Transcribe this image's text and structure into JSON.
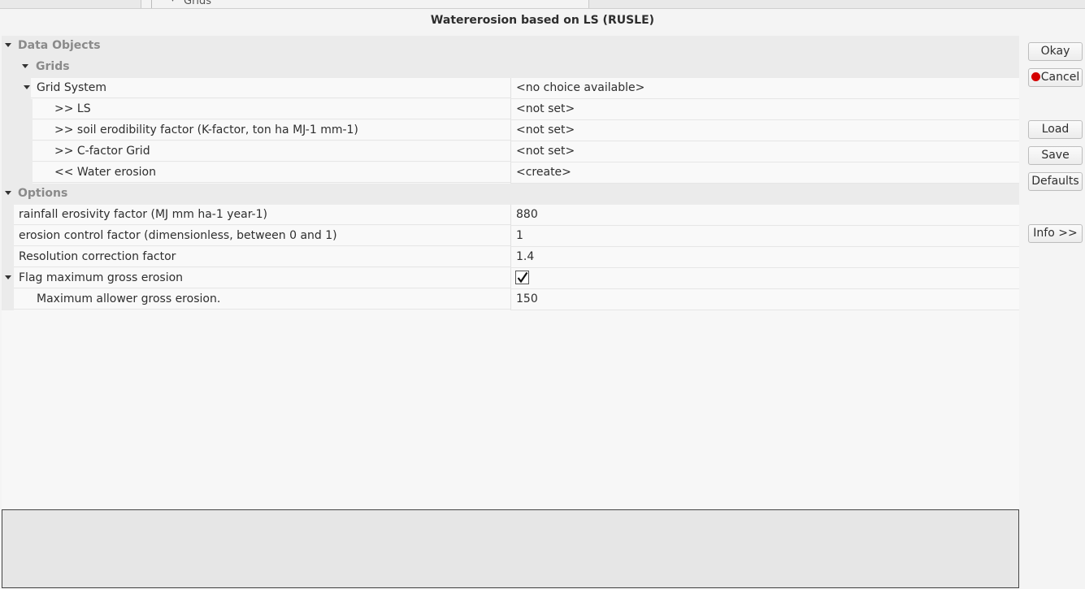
{
  "background_app": {
    "partial_label": "Grids"
  },
  "dialog": {
    "title": "Watererosion based on LS (RUSLE)"
  },
  "data_objects": {
    "label": "Data Objects",
    "grids_label": "Grids",
    "grid_system": {
      "label": "Grid System",
      "value": "<no choice available>"
    },
    "items": [
      {
        "label": ">> LS",
        "value": "<not set>"
      },
      {
        "label": ">> soil erodibility factor (K-factor, ton ha MJ-1 mm-1)",
        "value": "<not set>"
      },
      {
        "label": ">> C-factor Grid",
        "value": "<not set>"
      },
      {
        "label": "<< Water erosion",
        "value": "<create>"
      }
    ]
  },
  "options": {
    "label": "Options",
    "items": [
      {
        "label": "rainfall erosivity factor (MJ mm ha-1 year-1)",
        "value": "880"
      },
      {
        "label": "erosion control factor (dimensionless, between 0 and 1)",
        "value": "1"
      },
      {
        "label": "Resolution correction factor",
        "value": "1.4"
      }
    ],
    "flag": {
      "label": "Flag maximum gross erosion",
      "checked": true
    },
    "max_gross": {
      "label": "Maximum allower gross erosion.",
      "value": "150"
    }
  },
  "buttons": {
    "okay": "Okay",
    "cancel": "Cancel",
    "load": "Load",
    "save": "Save",
    "defaults": "Defaults",
    "info": "Info >>"
  },
  "colors": {
    "cancel_record_dot": "#d40000",
    "category_bg": "#ebebeb"
  }
}
